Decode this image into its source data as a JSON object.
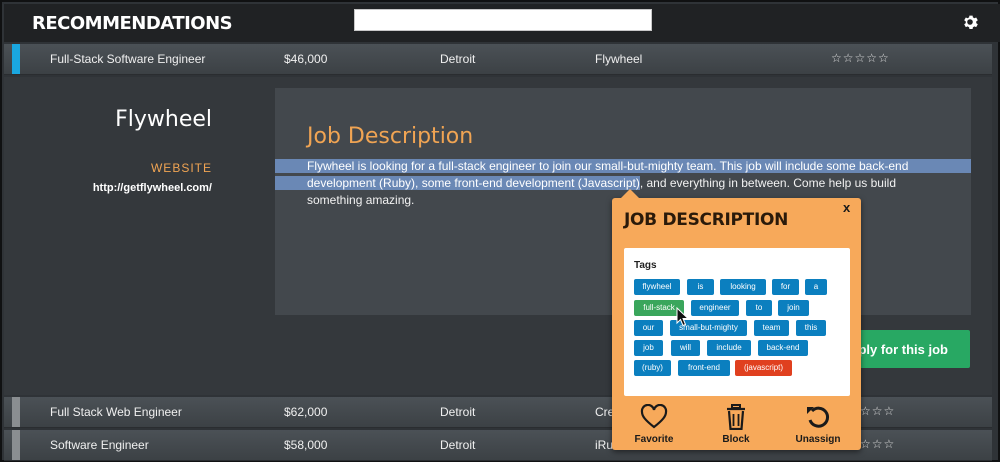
{
  "header": {
    "title": "RECOMMENDATIONS",
    "search_value": "",
    "settings_icon": "gear-icon"
  },
  "jobs": [
    {
      "title": "Full-Stack Software Engineer",
      "salary": "$46,000",
      "city": "Detroit",
      "company": "Flywheel",
      "stars": "☆☆☆☆☆",
      "active": true
    },
    {
      "title": "Full Stack Web Engineer",
      "salary": "$62,000",
      "city": "Detroit",
      "company": "Cre",
      "stars": "☆☆☆",
      "active": false
    },
    {
      "title": "Software Engineer",
      "salary": "$58,000",
      "city": "Detroit",
      "company": "iRu",
      "stars": "☆☆☆",
      "active": false
    }
  ],
  "detail": {
    "company_name": "Flywheel",
    "website_label": "WEBSITE",
    "website_url": "http://getflywheel.com/",
    "heading": "Job Description",
    "text_highlighted": "Flywheel is looking for a full-stack engineer to join our small-but-mighty team. This job will include some back-end development (Ruby), some front-end development (Javascript)",
    "text_rest": ", and everything in between. Come help us build something amazing.",
    "apply_label": "ply for this job"
  },
  "popup": {
    "title": "JOB DESCRIPTION",
    "close": "x",
    "tags_label": "Tags",
    "tags": [
      {
        "label": "flywheel",
        "state": "normal"
      },
      {
        "label": "is",
        "state": "normal"
      },
      {
        "label": "looking",
        "state": "normal"
      },
      {
        "label": "for",
        "state": "normal"
      },
      {
        "label": "a",
        "state": "normal"
      },
      {
        "label": "full-stack",
        "state": "selected"
      },
      {
        "label": "engineer",
        "state": "normal"
      },
      {
        "label": "to",
        "state": "normal"
      },
      {
        "label": "join",
        "state": "normal"
      },
      {
        "label": "our",
        "state": "normal"
      },
      {
        "label": "small-but-mighty",
        "state": "normal"
      },
      {
        "label": "team",
        "state": "normal"
      },
      {
        "label": "this",
        "state": "normal"
      },
      {
        "label": "job",
        "state": "normal"
      },
      {
        "label": "will",
        "state": "normal"
      },
      {
        "label": "include",
        "state": "normal"
      },
      {
        "label": "back-end",
        "state": "normal"
      },
      {
        "label": "(ruby)",
        "state": "normal"
      },
      {
        "label": "front-end",
        "state": "normal"
      },
      {
        "label": "(javascript)",
        "state": "highlighted"
      }
    ],
    "actions": [
      {
        "label": "Favorite",
        "icon": "heart-icon"
      },
      {
        "label": "Block",
        "icon": "trash-icon"
      },
      {
        "label": "Unassign",
        "icon": "undo-icon"
      }
    ]
  },
  "colors": {
    "accent_active": "#1aa7e0",
    "orange": "#f0a453",
    "apply_green": "#28a863",
    "tag_blue": "#0b7fbf",
    "tag_green": "#3aa65c",
    "tag_red": "#e0401f"
  }
}
